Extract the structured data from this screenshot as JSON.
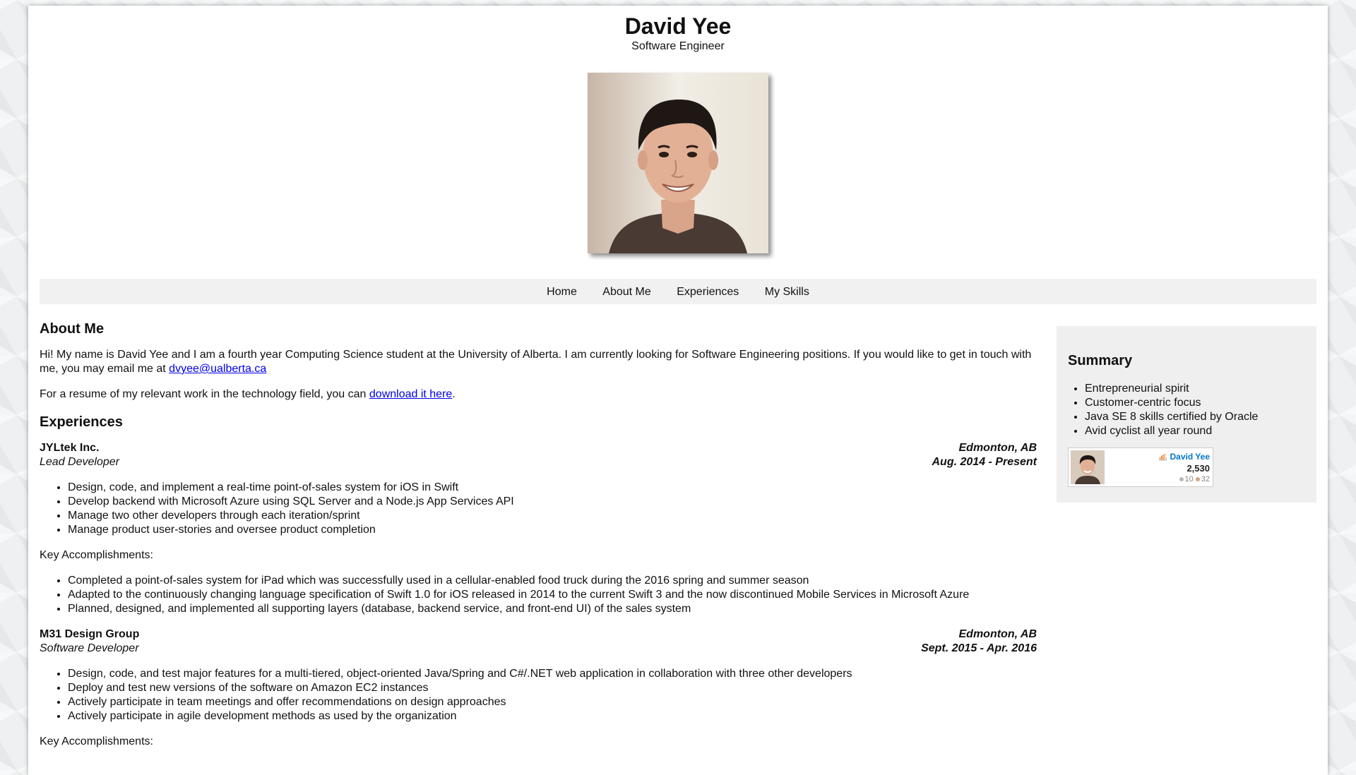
{
  "header": {
    "name": "David Yee",
    "subtitle": "Software Engineer"
  },
  "nav": {
    "items": [
      "Home",
      "About Me",
      "Experiences",
      "My Skills"
    ]
  },
  "about": {
    "heading": "About Me",
    "intro_text": "Hi! My name is David Yee and I am a fourth year Computing Science student at the University of Alberta. I am currently looking for Software Engineering positions. If you would like to get in touch with me, you may email me at ",
    "email": "dvyee@ualberta.ca",
    "resume_text": "For a resume of my relevant work in the technology field, you can ",
    "resume_link": "download it here",
    "resume_suffix": "."
  },
  "experiences": {
    "heading": "Experiences",
    "jobs": [
      {
        "company": "JYLtek Inc.",
        "role": "Lead Developer",
        "location": "Edmonton, AB",
        "dates": "Aug. 2014 - Present",
        "duties": [
          "Design, code, and implement a real-time point-of-sales system for iOS in Swift",
          "Develop backend with Microsoft Azure using SQL Server and a Node.js App Services API",
          "Manage two other developers through each iteration/sprint",
          "Manage product user-stories and oversee product completion"
        ],
        "accomplishments_label": "Key Accomplishments:",
        "accomplishments": [
          "Completed a point-of-sales system for iPad which was successfully used in a cellular-enabled food truck during the 2016 spring and summer season",
          "Adapted to the continuously changing language specification of Swift 1.0 for iOS released in 2014 to the current Swift 3 and the now discontinued Mobile Services in Microsoft Azure",
          "Planned, designed, and implemented all supporting layers (database, backend service, and front-end UI) of the sales system"
        ]
      },
      {
        "company": "M31 Design Group",
        "role": "Software Developer",
        "location": "Edmonton, AB",
        "dates": "Sept. 2015 - Apr. 2016",
        "duties": [
          "Design, code, and test major features for a multi-tiered, object-oriented Java/Spring and C#/.NET web application in collaboration with three other developers",
          "Deploy and test new versions of the software on Amazon EC2 instances",
          "Actively participate in team meetings and offer recommendations on design approaches",
          "Actively participate in agile development methods as used by the organization"
        ],
        "accomplishments_label": "Key Accomplishments:"
      }
    ]
  },
  "summary": {
    "heading": "Summary",
    "items": [
      "Entrepreneurial spirit",
      "Customer-centric focus",
      "Java SE 8 skills certified by Oracle",
      "Avid cyclist all year round"
    ]
  },
  "flair": {
    "name": "David Yee",
    "reputation": "2,530",
    "silver": "10",
    "bronze": "32",
    "silver_color": "#b4b8bc",
    "bronze_color": "#d1a684"
  }
}
